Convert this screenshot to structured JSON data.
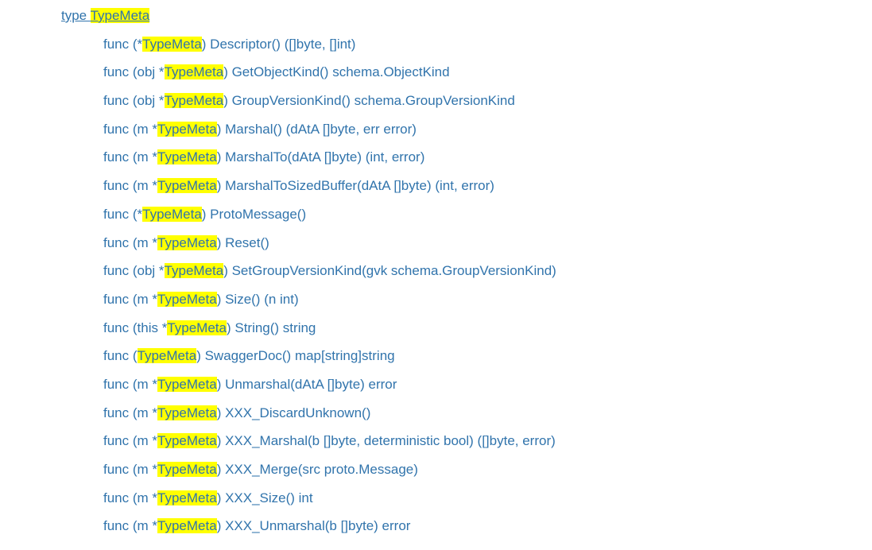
{
  "highlight_term": "TypeMeta",
  "type_line": {
    "keyword": "type ",
    "name": "TypeMeta"
  },
  "funcs": [
    {
      "prefix": "func (*",
      "hl": "TypeMeta",
      "suffix": ") Descriptor() ([]byte, []int)"
    },
    {
      "prefix": "func (obj *",
      "hl": "TypeMeta",
      "suffix": ") GetObjectKind() schema.ObjectKind"
    },
    {
      "prefix": "func (obj *",
      "hl": "TypeMeta",
      "suffix": ") GroupVersionKind() schema.GroupVersionKind"
    },
    {
      "prefix": "func (m *",
      "hl": "TypeMeta",
      "suffix": ") Marshal() (dAtA []byte, err error)"
    },
    {
      "prefix": "func (m *",
      "hl": "TypeMeta",
      "suffix": ") MarshalTo(dAtA []byte) (int, error)"
    },
    {
      "prefix": "func (m *",
      "hl": "TypeMeta",
      "suffix": ") MarshalToSizedBuffer(dAtA []byte) (int, error)"
    },
    {
      "prefix": "func (*",
      "hl": "TypeMeta",
      "suffix": ") ProtoMessage()"
    },
    {
      "prefix": "func (m *",
      "hl": "TypeMeta",
      "suffix": ") Reset()"
    },
    {
      "prefix": "func (obj *",
      "hl": "TypeMeta",
      "suffix": ") SetGroupVersionKind(gvk schema.GroupVersionKind)"
    },
    {
      "prefix": "func (m *",
      "hl": "TypeMeta",
      "suffix": ") Size() (n int)"
    },
    {
      "prefix": "func (this *",
      "hl": "TypeMeta",
      "suffix": ") String() string"
    },
    {
      "prefix": "func (",
      "hl": "TypeMeta",
      "suffix": ") SwaggerDoc() map[string]string"
    },
    {
      "prefix": "func (m *",
      "hl": "TypeMeta",
      "suffix": ") Unmarshal(dAtA []byte) error"
    },
    {
      "prefix": "func (m *",
      "hl": "TypeMeta",
      "suffix": ") XXX_DiscardUnknown()"
    },
    {
      "prefix": "func (m *",
      "hl": "TypeMeta",
      "suffix": ") XXX_Marshal(b []byte, deterministic bool) ([]byte, error)"
    },
    {
      "prefix": "func (m *",
      "hl": "TypeMeta",
      "suffix": ") XXX_Merge(src proto.Message)"
    },
    {
      "prefix": "func (m *",
      "hl": "TypeMeta",
      "suffix": ") XXX_Size() int"
    },
    {
      "prefix": "func (m *",
      "hl": "TypeMeta",
      "suffix": ") XXX_Unmarshal(b []byte) error"
    }
  ]
}
